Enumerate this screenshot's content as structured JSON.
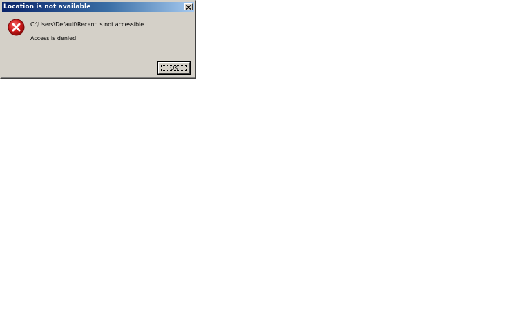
{
  "dialog": {
    "title": "Location is not available",
    "close_icon": "close-icon",
    "error_icon": "error-icon",
    "message_line_1": "C:\\Users\\Default\\Recent is not accessible.",
    "message_line_2": "Access is denied.",
    "ok_label": "OK"
  },
  "colors": {
    "dialog_face": "#d4d0c8",
    "titlebar_start": "#0a246a",
    "titlebar_end": "#a6caf0",
    "error_red": "#c8102e"
  }
}
